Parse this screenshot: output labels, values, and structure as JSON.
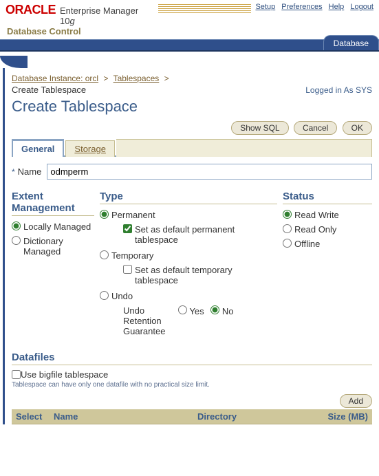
{
  "brand": {
    "logo": "ORACLE",
    "title_pre": "Enterprise Manager 10",
    "title_suf": "g",
    "subtitle": "Database Control"
  },
  "header_links": [
    "Setup",
    "Preferences",
    "Help",
    "Logout"
  ],
  "db_tab": "Database",
  "breadcrumb": {
    "items": [
      "Database Instance: orcl",
      "Tablespaces"
    ],
    "current": "Create Tablespace"
  },
  "logged_in": "Logged in As SYS",
  "page_title": "Create Tablespace",
  "buttons": {
    "show_sql": "Show SQL",
    "cancel": "Cancel",
    "ok": "OK",
    "add": "Add"
  },
  "tabs": {
    "general": "General",
    "storage": "Storage"
  },
  "form": {
    "name_label": "Name",
    "name_value": "odmperm"
  },
  "extent": {
    "heading": "Extent Management",
    "local": "Locally Managed",
    "dictionary": "Dictionary Managed"
  },
  "type": {
    "heading": "Type",
    "permanent": "Permanent",
    "perm_default": "Set as default permanent tablespace",
    "temporary": "Temporary",
    "temp_default": "Set as default temporary tablespace",
    "undo": "Undo",
    "undo_ret": "Undo Retention Guarantee",
    "yes": "Yes",
    "no": "No"
  },
  "status": {
    "heading": "Status",
    "rw": "Read Write",
    "ro": "Read Only",
    "offline": "Offline"
  },
  "datafiles": {
    "heading": "Datafiles",
    "bigfile": "Use bigfile tablespace",
    "hint": "Tablespace can have only one datafile with no practical size limit.",
    "cols": {
      "select": "Select",
      "name": "Name",
      "directory": "Directory",
      "size": "Size (MB)"
    }
  }
}
